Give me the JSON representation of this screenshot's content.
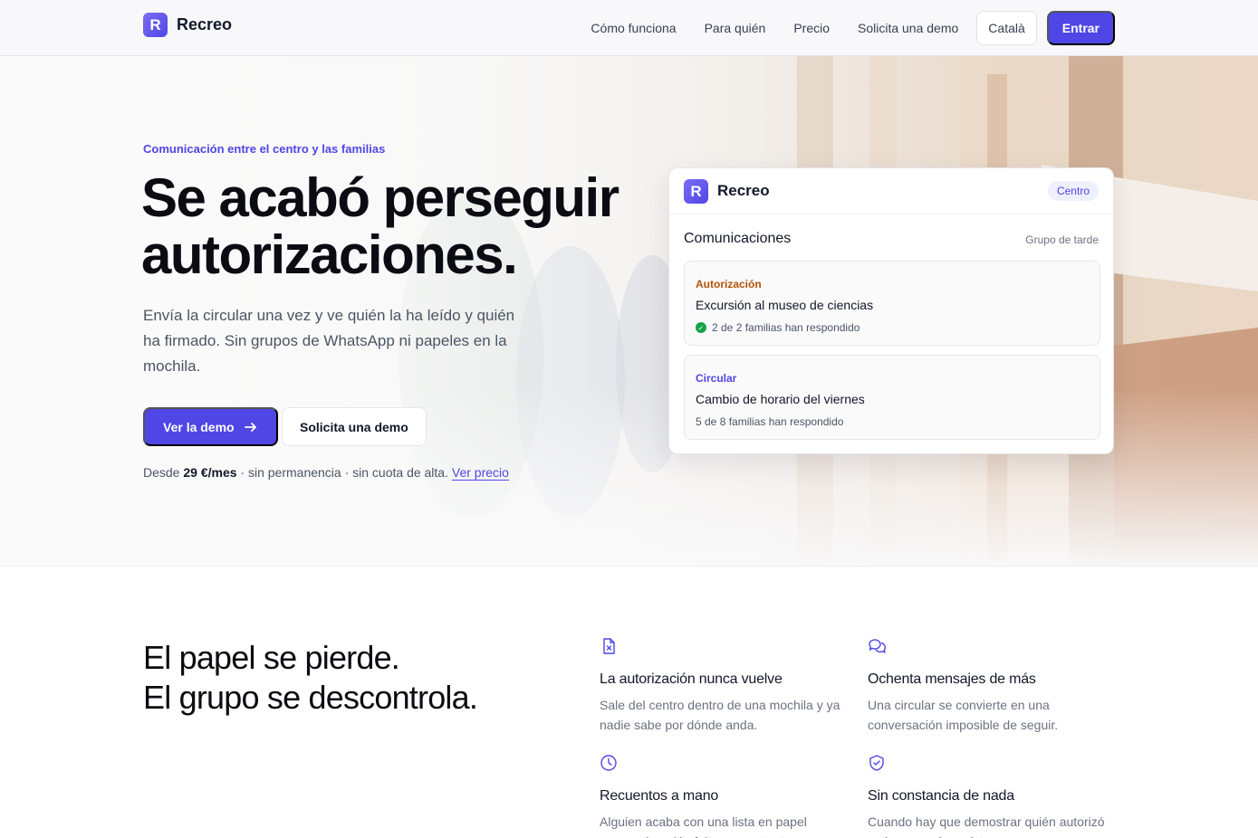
{
  "brand": {
    "name": "Recreo",
    "logo_letter": "R"
  },
  "nav": {
    "links": [
      "Cómo funciona",
      "Para quién",
      "Precio",
      "Solicita una demo"
    ],
    "language": "Català",
    "login": "Entrar"
  },
  "hero": {
    "eyebrow": "Comunicación entre el centro y las familias",
    "title": "Se acabó perseguir autorizaciones.",
    "subtitle": "Envía la circular una vez y ve quién la ha leído y quién ha firmado. Sin grupos de WhatsApp ni papeles en la mochila.",
    "cta_primary": "Ver la demo",
    "cta_secondary": "Solicita una demo",
    "pricing_prefix": "Desde",
    "pricing_amount": "29 €/mes",
    "pricing_suffix": "· sin permanencia · sin cuota de alta.",
    "pricing_link": "Ver precio"
  },
  "card": {
    "brand": "Recreo",
    "badge": "Centro",
    "section_title": "Comunicaciones",
    "section_meta": "Grupo de tarde",
    "items": [
      {
        "type": "Autorización",
        "title": "Excursión al museo de ciencias",
        "status": "2 de 2 familias han respondido",
        "complete": true
      },
      {
        "type": "Circular",
        "title": "Cambio de horario del viernes",
        "status": "5 de 8 familias han respondido",
        "complete": false
      }
    ]
  },
  "problems": {
    "title_line1": "El papel se pierde.",
    "title_line2": "El grupo se descontrola.",
    "features": [
      {
        "icon": "file-x-icon",
        "title": "La autorización nunca vuelve",
        "desc": "Sale del centro dentro de una mochila y ya nadie sabe por dónde anda."
      },
      {
        "icon": "chat-bubbles-icon",
        "title": "Ochenta mensajes de más",
        "desc": "Una circular se convierte en una conversación imposible de seguir."
      },
      {
        "icon": "clock-icon",
        "title": "Recuentos a mano",
        "desc": "Alguien acaba con una lista en papel marcando quién falta por contestar."
      },
      {
        "icon": "shield-check-icon",
        "title": "Sin constancia de nada",
        "desc": "Cuando hay que demostrar quién autorizó qué, no queda registro."
      }
    ]
  },
  "colors": {
    "accent": "#4f46e5",
    "authorization": "#b45309",
    "circular": "#4f46e5",
    "success": "#16a34a"
  }
}
